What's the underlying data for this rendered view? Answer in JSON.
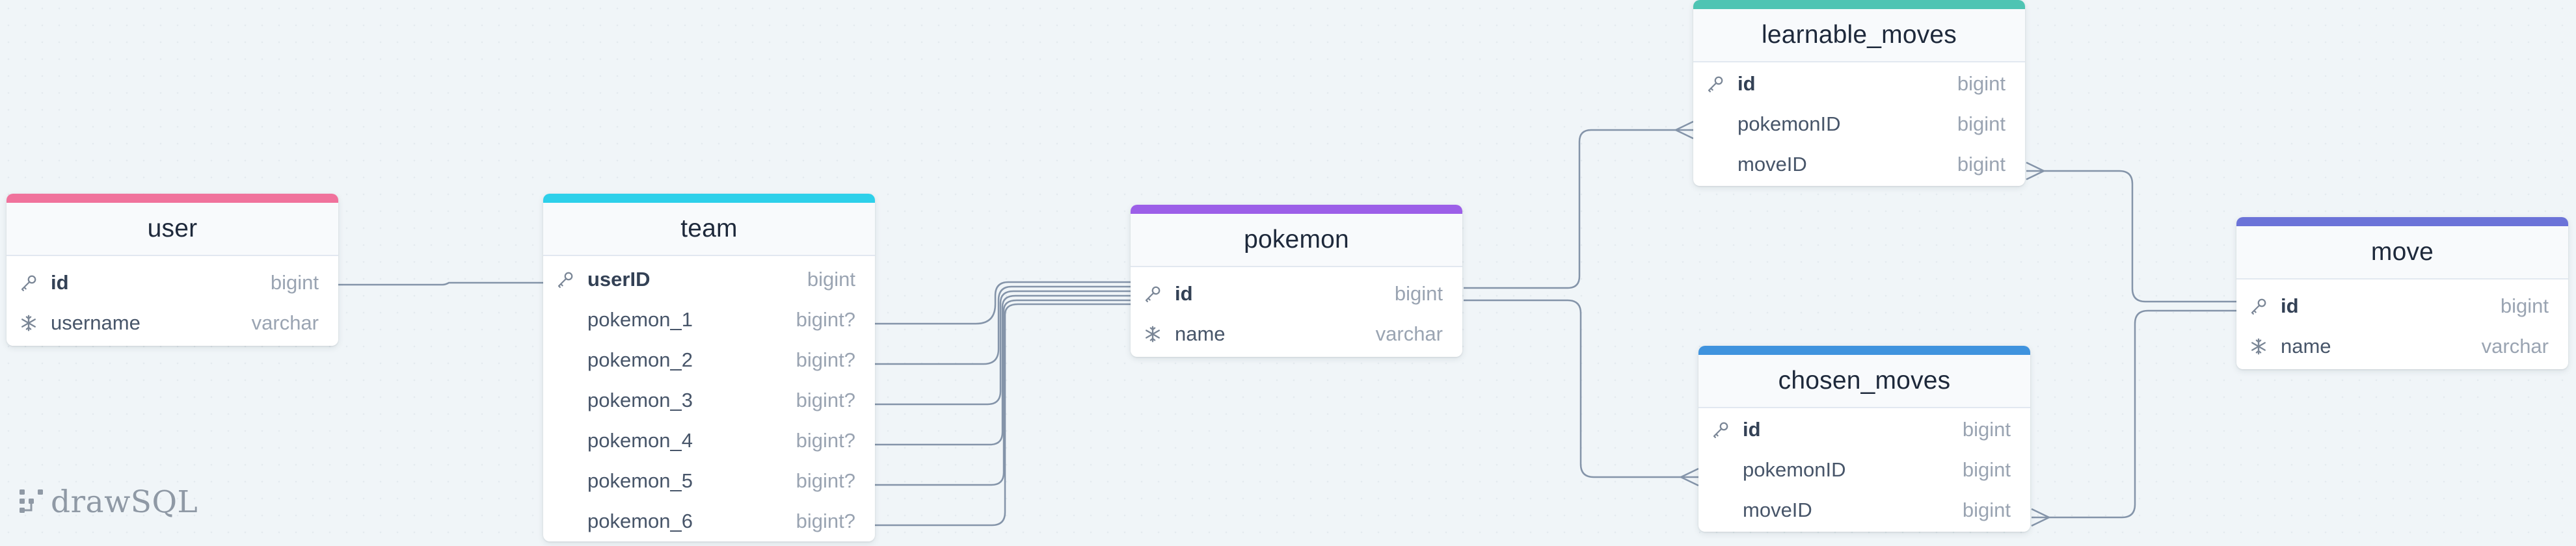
{
  "branding": {
    "logo_text": "drawSQL",
    "logo_icon": "drawsql-logo-icon"
  },
  "colors": {
    "canvas": "#f0f5f8",
    "connector": "#8494a9",
    "user_accent": "#f0729c",
    "team_accent": "#2dd0ea",
    "pokemon_accent": "#9c5fe8",
    "learnable_moves_accent": "#4ec4b3",
    "move_accent": "#6b73d8",
    "chosen_moves_accent": "#3f93de"
  },
  "icons": {
    "primary_key": "key-icon",
    "unique": "snowflake-icon"
  },
  "tables": {
    "user": {
      "name": "user",
      "columns": [
        {
          "name": "id",
          "type": "bigint",
          "icon": "key-icon"
        },
        {
          "name": "username",
          "type": "varchar",
          "icon": "snowflake-icon"
        }
      ]
    },
    "team": {
      "name": "team",
      "columns": [
        {
          "name": "userID",
          "type": "bigint",
          "icon": "key-icon"
        },
        {
          "name": "pokemon_1",
          "type": "bigint?",
          "icon": ""
        },
        {
          "name": "pokemon_2",
          "type": "bigint?",
          "icon": ""
        },
        {
          "name": "pokemon_3",
          "type": "bigint?",
          "icon": ""
        },
        {
          "name": "pokemon_4",
          "type": "bigint?",
          "icon": ""
        },
        {
          "name": "pokemon_5",
          "type": "bigint?",
          "icon": ""
        },
        {
          "name": "pokemon_6",
          "type": "bigint?",
          "icon": ""
        }
      ]
    },
    "pokemon": {
      "name": "pokemon",
      "columns": [
        {
          "name": "id",
          "type": "bigint",
          "icon": "key-icon"
        },
        {
          "name": "name",
          "type": "varchar",
          "icon": "snowflake-icon"
        }
      ]
    },
    "learnable_moves": {
      "name": "learnable_moves",
      "columns": [
        {
          "name": "id",
          "type": "bigint",
          "icon": "key-icon"
        },
        {
          "name": "pokemonID",
          "type": "bigint",
          "icon": ""
        },
        {
          "name": "moveID",
          "type": "bigint",
          "icon": ""
        }
      ]
    },
    "chosen_moves": {
      "name": "chosen_moves",
      "columns": [
        {
          "name": "id",
          "type": "bigint",
          "icon": "key-icon"
        },
        {
          "name": "pokemonID",
          "type": "bigint",
          "icon": ""
        },
        {
          "name": "moveID",
          "type": "bigint",
          "icon": ""
        }
      ]
    },
    "move": {
      "name": "move",
      "columns": [
        {
          "name": "id",
          "type": "bigint",
          "icon": "key-icon"
        },
        {
          "name": "name",
          "type": "varchar",
          "icon": "snowflake-icon"
        }
      ]
    }
  },
  "relations": [
    {
      "from": "user.id",
      "to": "team.userID",
      "cardinality": "one-to-one"
    },
    {
      "from": "team.pokemon_1",
      "to": "pokemon.id",
      "cardinality": "one-to-one"
    },
    {
      "from": "team.pokemon_2",
      "to": "pokemon.id",
      "cardinality": "one-to-one"
    },
    {
      "from": "team.pokemon_3",
      "to": "pokemon.id",
      "cardinality": "one-to-one"
    },
    {
      "from": "team.pokemon_4",
      "to": "pokemon.id",
      "cardinality": "one-to-one"
    },
    {
      "from": "team.pokemon_5",
      "to": "pokemon.id",
      "cardinality": "one-to-one"
    },
    {
      "from": "team.pokemon_6",
      "to": "pokemon.id",
      "cardinality": "one-to-one"
    },
    {
      "from": "pokemon.id",
      "to": "learnable_moves.pokemonID",
      "cardinality": "one-to-many"
    },
    {
      "from": "pokemon.id",
      "to": "chosen_moves.pokemonID",
      "cardinality": "one-to-many"
    },
    {
      "from": "move.id",
      "to": "learnable_moves.moveID",
      "cardinality": "one-to-many"
    },
    {
      "from": "move.id",
      "to": "chosen_moves.moveID",
      "cardinality": "one-to-many"
    }
  ]
}
